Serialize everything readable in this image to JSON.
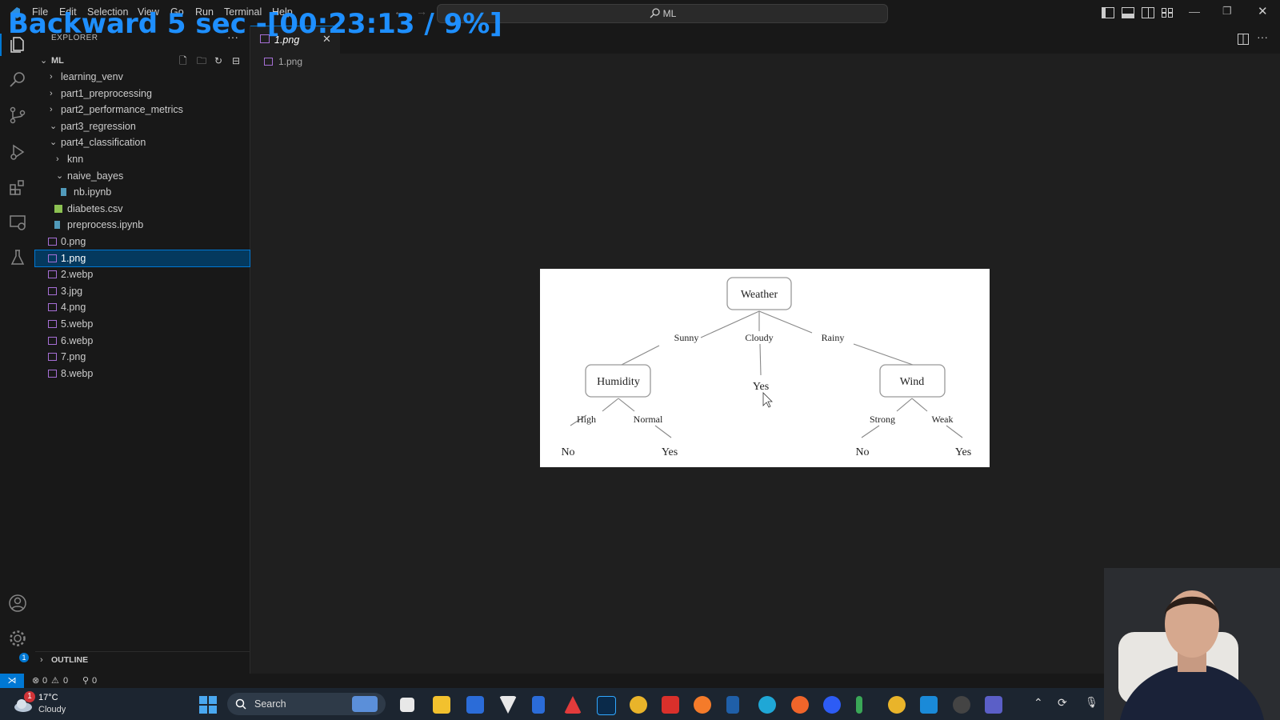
{
  "overlay": {
    "text": "Backward 5 sec -[00:23:13 / 9%]"
  },
  "menu": [
    "File",
    "Edit",
    "Selection",
    "View",
    "Go",
    "Run",
    "Terminal",
    "Help"
  ],
  "command_center": {
    "text": "ML"
  },
  "explorer": {
    "header": "EXPLORER",
    "folder": "ML",
    "tree": [
      {
        "label": "learning_venv",
        "kind": "folder",
        "expanded": false,
        "level": 1
      },
      {
        "label": "part1_preprocessing",
        "kind": "folder",
        "expanded": false,
        "level": 1
      },
      {
        "label": "part2_performance_metrics",
        "kind": "folder",
        "expanded": false,
        "level": 1
      },
      {
        "label": "part3_regression",
        "kind": "folder",
        "expanded": true,
        "level": 1
      },
      {
        "label": "part4_classification",
        "kind": "folder",
        "expanded": true,
        "level": 1
      },
      {
        "label": "knn",
        "kind": "folder",
        "expanded": false,
        "level": 2
      },
      {
        "label": "naive_bayes",
        "kind": "folder",
        "expanded": true,
        "level": 2
      },
      {
        "label": "nb.ipynb",
        "kind": "notebook",
        "level": 3
      },
      {
        "label": "diabetes.csv",
        "kind": "csv",
        "level": 2
      },
      {
        "label": "preprocess.ipynb",
        "kind": "notebook",
        "level": 2
      },
      {
        "label": "0.png",
        "kind": "image",
        "level": 1
      },
      {
        "label": "1.png",
        "kind": "image",
        "level": 1,
        "selected": true
      },
      {
        "label": "2.webp",
        "kind": "image",
        "level": 1
      },
      {
        "label": "3.jpg",
        "kind": "image",
        "level": 1
      },
      {
        "label": "4.png",
        "kind": "image",
        "level": 1
      },
      {
        "label": "5.webp",
        "kind": "image",
        "level": 1
      },
      {
        "label": "6.webp",
        "kind": "image",
        "level": 1
      },
      {
        "label": "7.png",
        "kind": "image",
        "level": 1
      },
      {
        "label": "8.webp",
        "kind": "image",
        "level": 1
      }
    ],
    "outline": "OUTLINE"
  },
  "editor": {
    "tab_label": "1.png",
    "breadcrumb": "1.png"
  },
  "tree_diagram": {
    "root": "Weather",
    "branches": [
      "Sunny",
      "Cloudy",
      "Rainy"
    ],
    "humidity": "Humidity",
    "humidity_branches": [
      "High",
      "Normal"
    ],
    "humidity_leaves": [
      "No",
      "Yes"
    ],
    "cloudy_leaf": "Yes",
    "wind": "Wind",
    "wind_branches": [
      "Strong",
      "Weak"
    ],
    "wind_leaves": [
      "No",
      "Yes"
    ]
  },
  "statusbar": {
    "errors": "0",
    "warnings": "0",
    "ports": "0"
  },
  "taskbar": {
    "weather_temp": "17°C",
    "weather_desc": "Cloudy",
    "weather_badge": "1",
    "search_placeholder": "Search"
  },
  "colors": {
    "accent": "#0078d4",
    "overlay": "#1e8fff",
    "selection": "#04395e"
  }
}
